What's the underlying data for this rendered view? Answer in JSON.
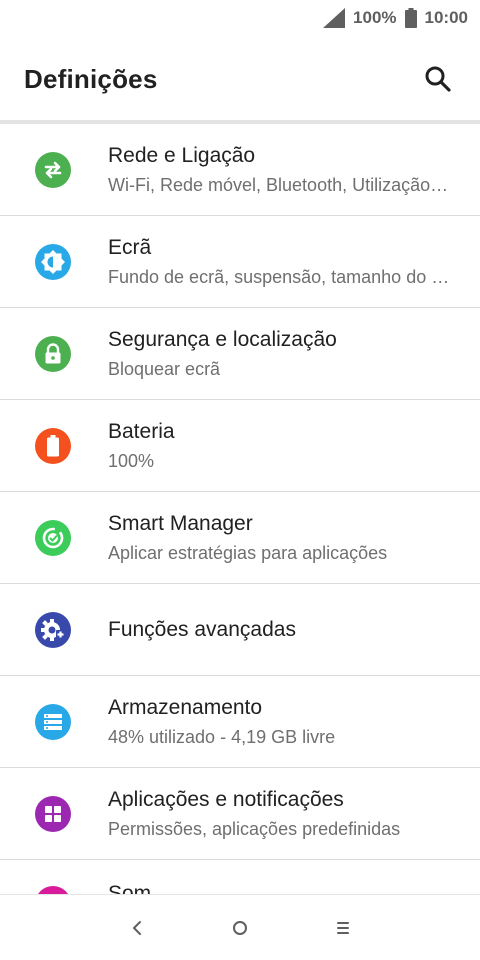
{
  "status_bar": {
    "battery_percent": "100%",
    "time": "10:00"
  },
  "app_bar": {
    "title": "Definições"
  },
  "items": [
    {
      "title": "Rede e Ligação",
      "subtitle": "Wi-Fi, Rede móvel, Bluetooth, Utilização de dados",
      "icon": "swap-arrows-icon",
      "color": "#4caf50"
    },
    {
      "title": "Ecrã",
      "subtitle": "Fundo de ecrã, suspensão, tamanho do tipo de letra",
      "icon": "brightness-icon",
      "color": "#29a8e8"
    },
    {
      "title": "Segurança e localização",
      "subtitle": "Bloquear ecrã",
      "icon": "lock-icon",
      "color": "#4caf50"
    },
    {
      "title": "Bateria",
      "subtitle": "100%",
      "icon": "battery-icon",
      "color": "#f4511e"
    },
    {
      "title": "Smart Manager",
      "subtitle": "Aplicar estratégias para aplicações",
      "icon": "smart-manager-icon",
      "color": "#3ccc5a"
    },
    {
      "title": "Funções avançadas",
      "subtitle": "",
      "icon": "gear-plus-icon",
      "color": "#3949ab"
    },
    {
      "title": "Armazenamento",
      "subtitle": "48% utilizado - 4,19 GB livre",
      "icon": "storage-icon",
      "color": "#29a8e8"
    },
    {
      "title": "Aplicações e notificações",
      "subtitle": "Permissões, aplicações predefinidas",
      "icon": "apps-grid-icon",
      "color": "#9c27b0"
    },
    {
      "title": "Som",
      "subtitle": "",
      "icon": "sound-icon",
      "color": "#d81b9a"
    }
  ]
}
